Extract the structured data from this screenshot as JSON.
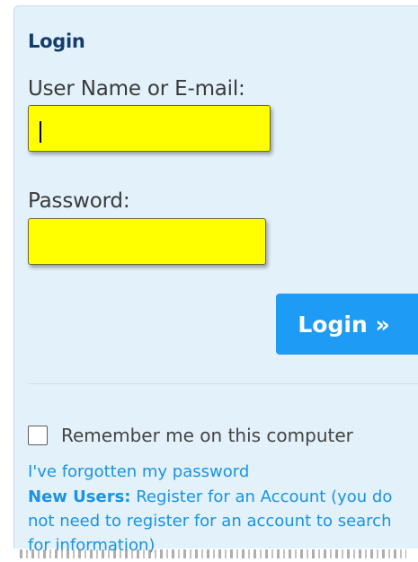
{
  "login": {
    "title": "Login",
    "username_label": "User Name or E-mail:",
    "username_value": "",
    "password_label": "Password:",
    "password_value": "",
    "submit_label": "Login »",
    "remember_label": "Remember me on this computer",
    "remember_checked": false,
    "forgot_link": "I've forgotten my password",
    "new_users_prefix": "New Users:",
    "register_text": " Register for an Account (you do not need to register for an account to search for information)"
  },
  "colors": {
    "panel_bg": "#e3f1fb",
    "title": "#143d6e",
    "input_bg": "#ffff00",
    "button_bg": "#1e9bf5",
    "link": "#1a93e0"
  }
}
